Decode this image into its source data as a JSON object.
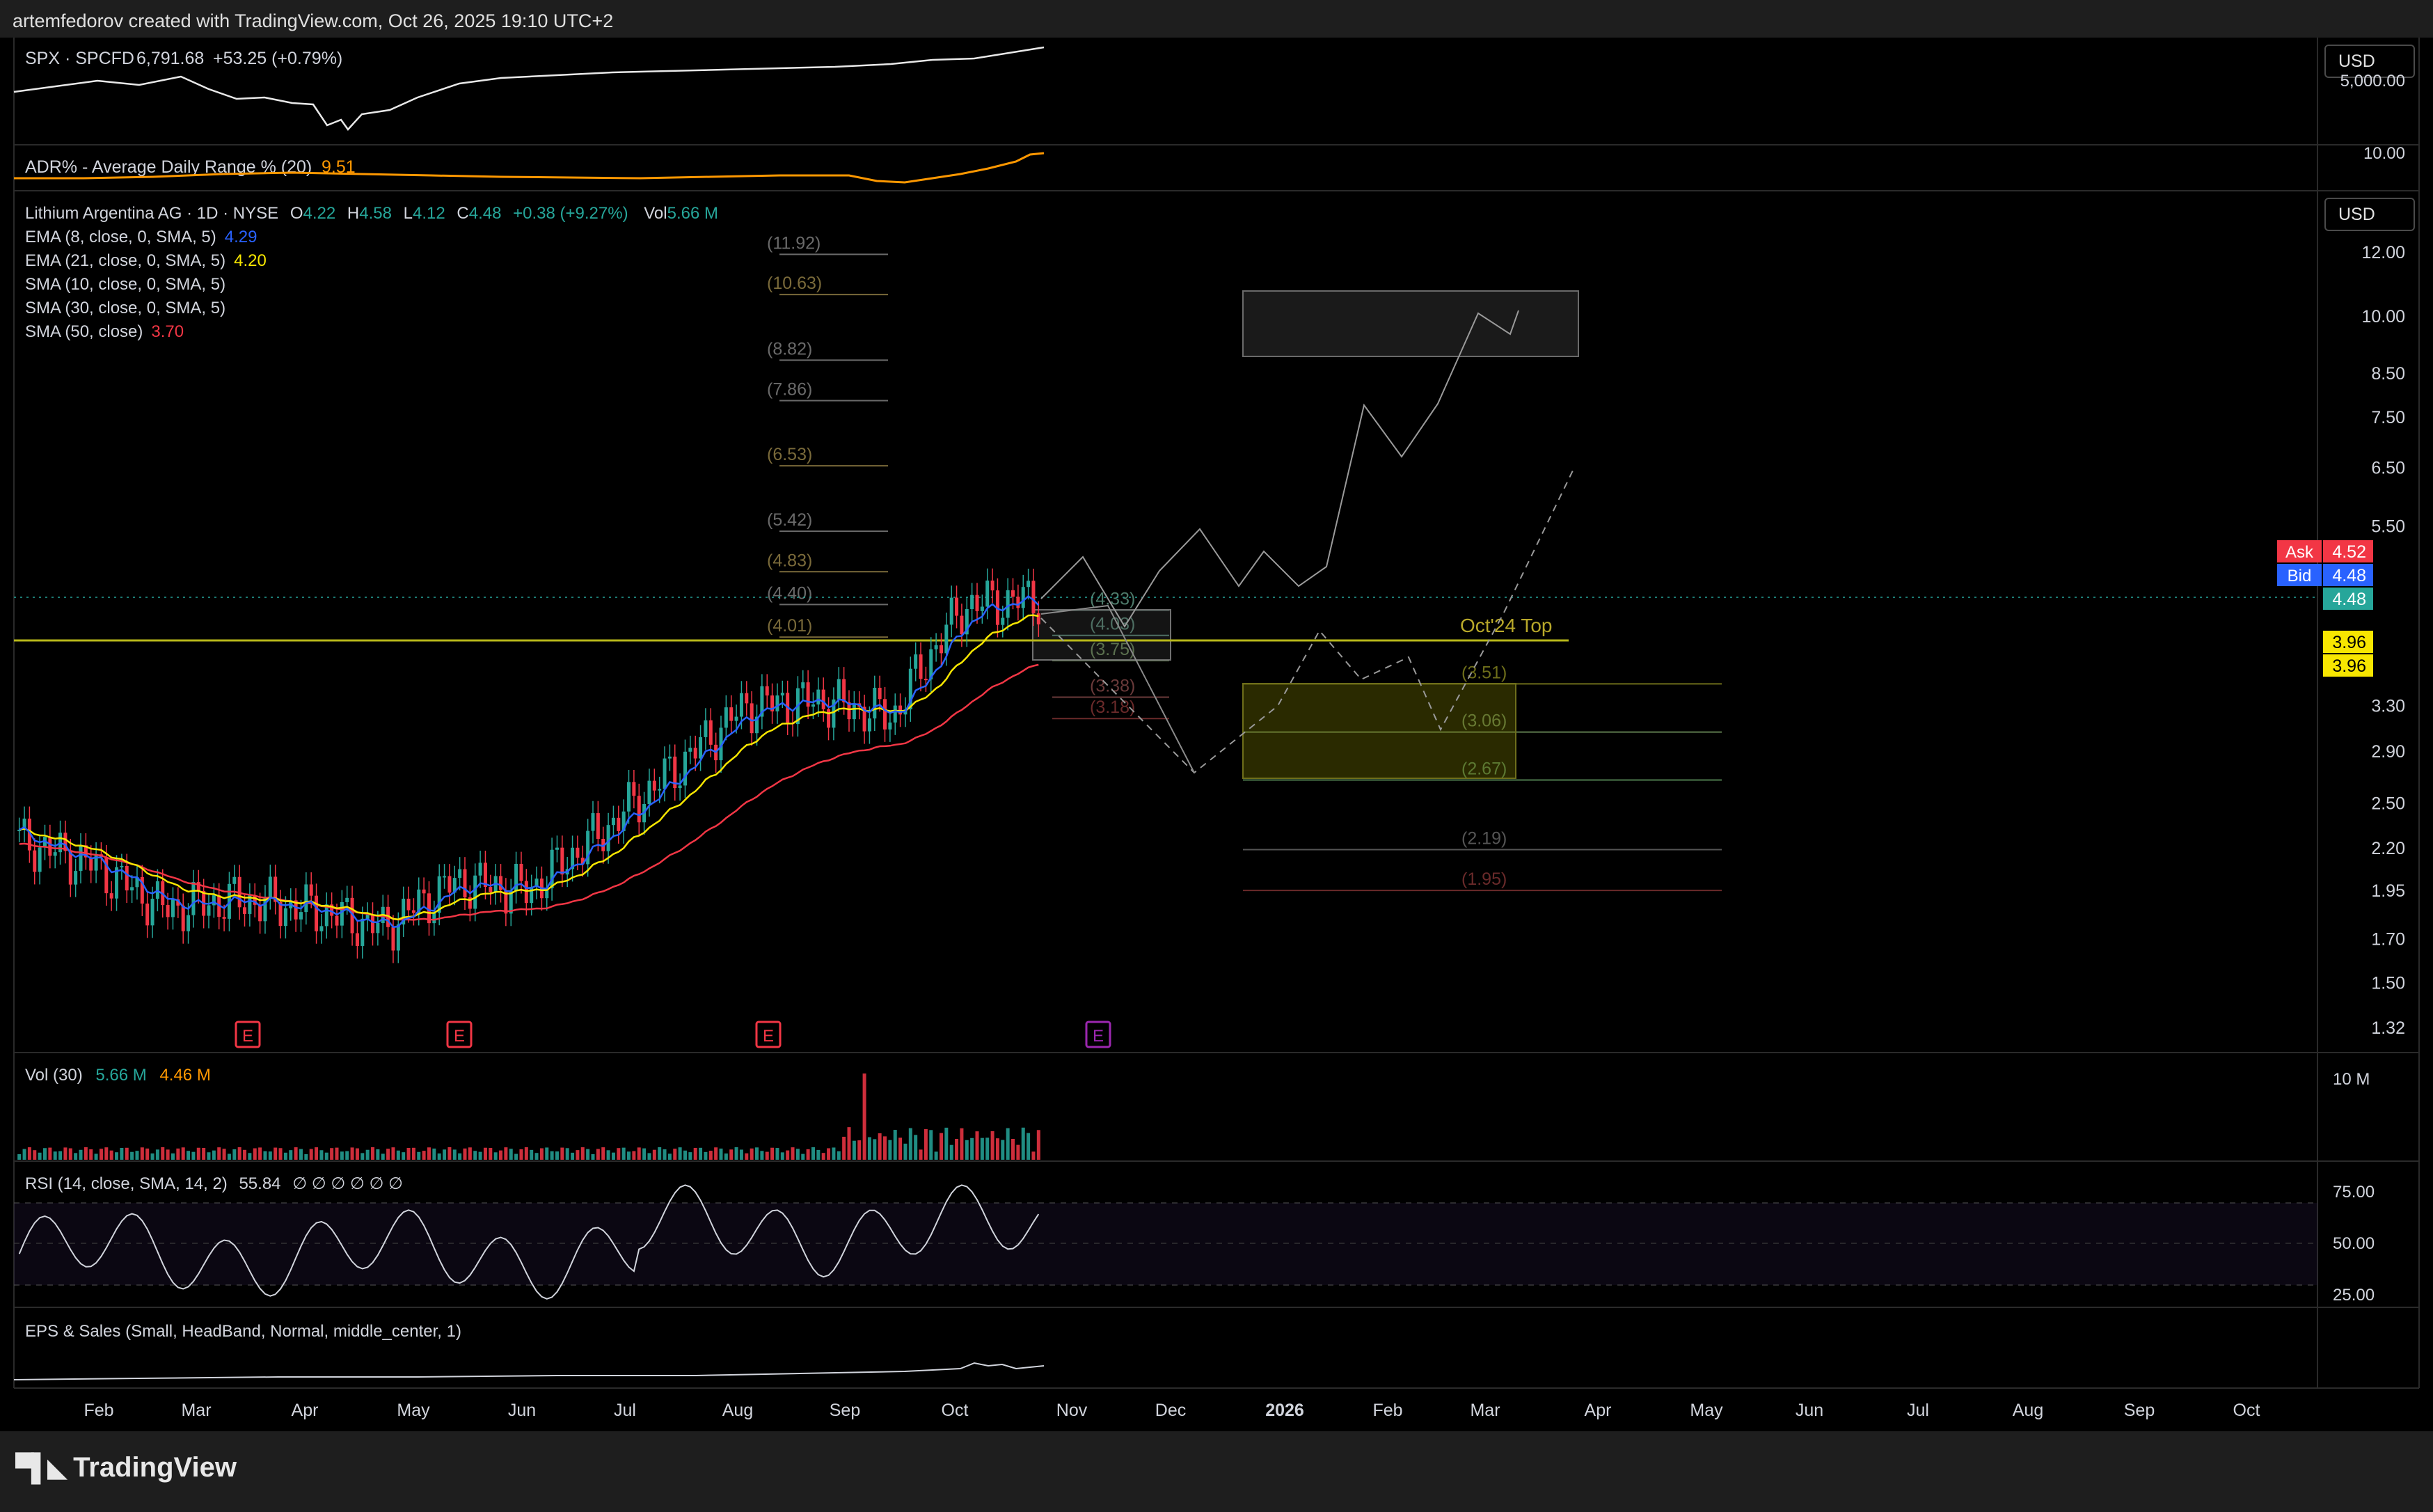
{
  "header": {
    "text": "artemfedorov created with TradingView.com, Oct 26, 2025 19:10 UTC+2"
  },
  "footer": {
    "brand": "TradingView"
  },
  "currency": {
    "top": "USD",
    "main": "USD"
  },
  "panes": {
    "spx": {
      "label": "SPX · SPCFD",
      "value": "6,791.68",
      "change": "+53.25 (+0.79%)",
      "axis": [
        "5,000.00"
      ]
    },
    "adr": {
      "label": "ADR% - Average Daily Range % (20)",
      "value": "9.51",
      "axis": [
        "10.00"
      ]
    },
    "main": {
      "title": "Lithium Argentina AG · 1D · NYSE",
      "o_label": "O",
      "o": "4.22",
      "h_label": "H",
      "h": "4.58",
      "l_label": "L",
      "l": "4.12",
      "c_label": "C",
      "c": "4.48",
      "chg": "+0.38 (+9.27%)",
      "vol_label": "Vol",
      "vol": "5.66 M",
      "indicators": [
        {
          "label": "EMA (8, close, 0, SMA, 5)",
          "value": "4.29",
          "color": "#2962ff"
        },
        {
          "label": "EMA (21, close, 0, SMA, 5)",
          "value": "4.20",
          "color": "#f7e600"
        },
        {
          "label": "SMA (10, close, 0, SMA, 5)",
          "value": "",
          "color": "#d1d4dc"
        },
        {
          "label": "SMA (30, close, 0, SMA, 5)",
          "value": "",
          "color": "#d1d4dc"
        },
        {
          "label": "SMA (50, close)",
          "value": "3.70",
          "color": "#f23645"
        }
      ]
    },
    "vol": {
      "label": "Vol (30)",
      "v1": "5.66 M",
      "v2": "4.46 M",
      "axis": "10 M"
    },
    "rsi": {
      "label": "RSI (14, close, SMA, 14, 2)",
      "value": "55.84",
      "extra": "∅ ∅ ∅ ∅ ∅ ∅",
      "axis": [
        "75.00",
        "50.00",
        "25.00"
      ]
    },
    "eps": {
      "label": "EPS & Sales (Small, HeadBand, Normal, middle_center, 1)"
    }
  },
  "chart_data": {
    "type": "candlestick",
    "symbol": "Lithium Argentina AG",
    "interval": "1D",
    "exchange": "NYSE",
    "y_scale": "log",
    "ylim": [
      1.28,
      13.0
    ],
    "y_ticks": [
      "12.00",
      "10.00",
      "8.50",
      "7.50",
      "6.50",
      "5.50",
      "3.30",
      "2.90",
      "2.50",
      "2.20",
      "1.95",
      "1.70",
      "1.50",
      "1.32"
    ],
    "x_ticks": [
      "Feb",
      "Mar",
      "Apr",
      "May",
      "Jun",
      "Jul",
      "Aug",
      "Sep",
      "Oct",
      "Nov",
      "Dec",
      "2026",
      "Feb",
      "Mar",
      "Apr",
      "May",
      "Jun",
      "Jul",
      "Aug",
      "Sep",
      "Oct"
    ],
    "price_badges": [
      {
        "label": "Ask",
        "value": "4.52",
        "color": "#f23645"
      },
      {
        "label": "Bid",
        "value": "4.48",
        "color": "#2962ff"
      },
      {
        "label": "",
        "value": "4.48",
        "color": "#26a69a"
      },
      {
        "label": "",
        "value": "3.96",
        "color": "#f7e600"
      },
      {
        "label": "",
        "value": "3.96",
        "color": "#f7e600"
      }
    ],
    "fib_levels_left": [
      "(11.92)",
      "(10.63)",
      "(8.82)",
      "(7.86)",
      "(6.53)",
      "(5.42)",
      "(4.83)",
      "(4.40)",
      "(4.01)"
    ],
    "fib_levels_mid": [
      "(4.33)",
      "(4.03)",
      "(3.75)",
      "(3.38)",
      "(3.18)"
    ],
    "fib_levels_right": [
      "(3.51)",
      "(3.06)",
      "(2.67)",
      "(2.19)",
      "(1.95)"
    ],
    "horizontal_line": {
      "label": "Oct'24 Top",
      "value": 3.96
    },
    "earnings_markers": [
      "E",
      "E",
      "E",
      "E"
    ],
    "projected_path": [
      [
        4.6,
        2.75
      ],
      [
        5.3,
        2.7
      ],
      [
        4.9,
        3.5
      ],
      [
        7.8,
        6.6
      ],
      [
        7.3,
        10.2
      ]
    ],
    "approx_close_path": [
      2.25,
      2.1,
      1.85,
      1.9,
      1.85,
      1.75,
      2.0,
      1.95,
      2.3,
      2.75,
      3.3,
      3.35,
      3.2,
      4.4,
      4.48
    ]
  }
}
